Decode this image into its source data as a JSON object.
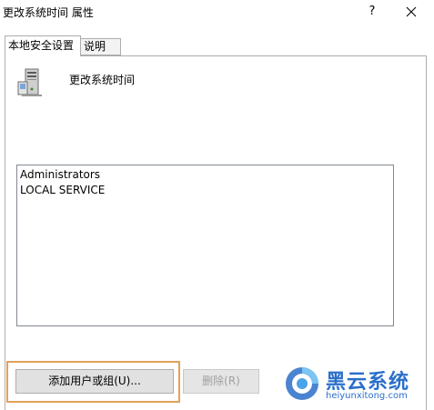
{
  "window": {
    "title": "更改系统时间 属性",
    "help_label": "?",
    "close_icon": "close-icon"
  },
  "tabs": [
    {
      "label": "本地安全设置",
      "selected": true
    },
    {
      "label": "说明",
      "selected": false
    }
  ],
  "policy": {
    "icon": "server-icon",
    "name": "更改系统时间"
  },
  "members": [
    "Administrators",
    "LOCAL SERVICE"
  ],
  "buttons": {
    "add_label": "添加用户或组(U)...",
    "remove_label": "删除(R)"
  },
  "watermark": {
    "brand": "黑云系统",
    "domain": "heiyunxitong.com"
  },
  "colors": {
    "highlight_border": "#e0a15a",
    "watermark_blue": "#2a6fc9"
  }
}
